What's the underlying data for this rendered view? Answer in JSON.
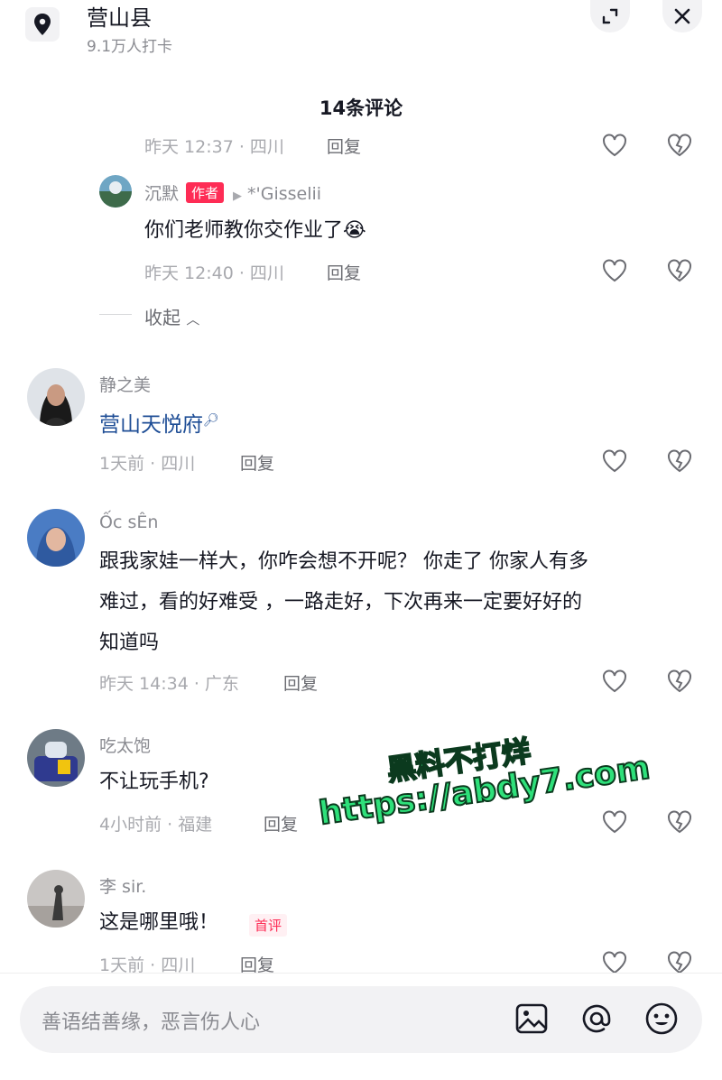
{
  "header": {
    "location_name": "营山县",
    "checkins": "9.1万人打卡"
  },
  "comments_title": "14条评论",
  "partial_meta": {
    "time_loc": "昨天 12:37 · 四川",
    "reply": "回复"
  },
  "reply_item": {
    "user": "沉默",
    "badge": "作者",
    "target": "*'Gisselii",
    "text": "你们老师教你交作业了",
    "emoji": "😭",
    "time_loc": "昨天 12:40 · 四川",
    "reply": "回复"
  },
  "collapse_label": "收起",
  "comments": [
    {
      "user": "静之美",
      "text": "营山天悦府",
      "time_loc": "1天前 · 四川",
      "reply": "回复"
    },
    {
      "user": "Ốc sÊn",
      "text_lines": [
        "跟我家娃一样大，你咋会想不开呢？ 你走了 你家人有多",
        "难过，看的好难受 ，一路走好，下次再来一定要好好的",
        "知道吗"
      ],
      "time_loc": "昨天 14:34 · 广东",
      "reply": "回复"
    },
    {
      "user": "吃太饱",
      "text": "不让玩手机?",
      "time_loc": "4小时前 · 福建",
      "reply": "回复"
    },
    {
      "user": "李 sir.",
      "text": "这是哪里哦！",
      "badge": "首评",
      "time_loc": "1天前 · 四川",
      "reply": "回复"
    }
  ],
  "input": {
    "placeholder": "善语结善缘，恶言伤人心"
  },
  "watermark": {
    "line1": "黑料不打烊",
    "line2": "https://abdy7.com"
  },
  "colors": {
    "accent": "#fe2c55",
    "link": "#1f4e96",
    "watermark": "#2ee07a"
  }
}
